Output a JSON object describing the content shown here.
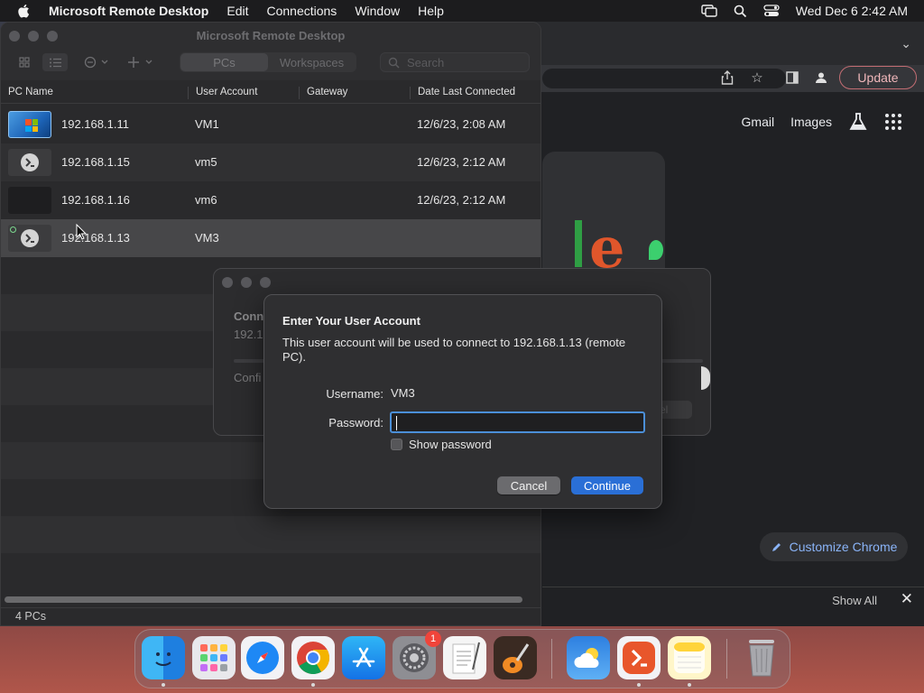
{
  "menubar": {
    "app_name": "Microsoft Remote Desktop",
    "menus": [
      "Edit",
      "Connections",
      "Window",
      "Help"
    ],
    "datetime": "Wed Dec 6  2:42 AM"
  },
  "chrome": {
    "update_label": "Update",
    "links": {
      "gmail": "Gmail",
      "images": "Images"
    },
    "customize_label": "Customize Chrome",
    "show_all_label": "Show All"
  },
  "rdp": {
    "window_title": "Microsoft Remote Desktop",
    "tabs": {
      "pcs": "PCs",
      "workspaces": "Workspaces"
    },
    "search_placeholder": "Search",
    "columns": {
      "pc_name": "PC Name",
      "user_account": "User Account",
      "gateway": "Gateway",
      "date": "Date Last Connected"
    },
    "rows": [
      {
        "pc": "192.168.1.11",
        "user": "VM1",
        "gateway": "",
        "date": "12/6/23, 2:08 AM",
        "thumb": "windows-7-desktop"
      },
      {
        "pc": "192.168.1.15",
        "user": "vm5",
        "gateway": "",
        "date": "12/6/23, 2:12 AM",
        "thumb": "remote-desktop-icon"
      },
      {
        "pc": "192.168.1.16",
        "user": "vm6",
        "gateway": "",
        "date": "12/6/23, 2:12 AM",
        "thumb": "blank-screen"
      },
      {
        "pc": "192.168.1.13",
        "user": "VM3",
        "gateway": "",
        "date": "",
        "thumb": "remote-desktop-icon"
      }
    ],
    "status_count": "4 PCs"
  },
  "connect_sheet": {
    "line1": "Conn",
    "line2": "192.1",
    "line3": "Confi",
    "cancel_partial": "cel"
  },
  "dialog": {
    "title": "Enter Your User Account",
    "message": "This user account will be used to connect to 192.168.1.13 (remote PC).",
    "username_label": "Username:",
    "username_value": "VM3",
    "password_label": "Password:",
    "password_value": "",
    "show_password_label": "Show password",
    "show_password_checked": false,
    "cancel_label": "Cancel",
    "continue_label": "Continue",
    "accent_color": "#2a6fd6"
  },
  "dock": {
    "apps": [
      "Finder",
      "Launchpad",
      "Safari",
      "Google Chrome",
      "App Store",
      "System Settings",
      "TextEdit",
      "GarageBand",
      "Weather",
      "Microsoft Remote Desktop",
      "Notes",
      "Trash"
    ],
    "system_settings_badge": "1"
  }
}
